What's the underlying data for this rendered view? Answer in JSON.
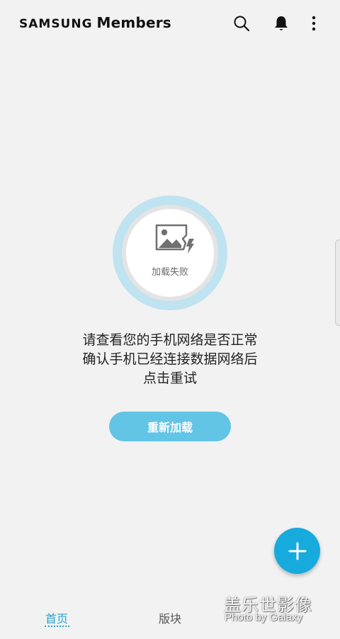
{
  "header": {
    "brand": "SAMSUNG",
    "product": "Members",
    "icons": [
      "search-icon",
      "bell-icon",
      "more-vertical-icon"
    ]
  },
  "error": {
    "icon": "broken-image-icon",
    "label": "加载失败",
    "message_lines": [
      "请查看您的手机网络是否正常",
      "确认手机已经连接数据网络后",
      "点击重试"
    ],
    "reload_label": "重新加载"
  },
  "fab": {
    "icon": "plus-icon",
    "color": "#17aadc"
  },
  "bottom_nav": {
    "tabs": [
      {
        "label": "首页",
        "active": true
      },
      {
        "label": "版块",
        "active": false
      },
      {
        "label": "",
        "active": false
      }
    ],
    "active_color": "#2aa4d4"
  },
  "watermark": {
    "title": "盖乐世影像",
    "subtitle": "Photo by Galaxy"
  },
  "colors": {
    "background": "#f2f2f2",
    "ring": "#bfe3f0",
    "button": "#62c5e6"
  }
}
